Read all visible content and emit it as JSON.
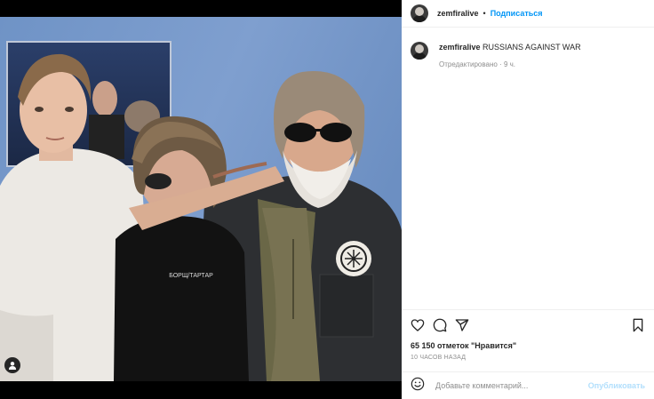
{
  "post": {
    "username": "zemfiralive",
    "follow_label": "Подписаться",
    "separator": "•",
    "caption_text": "RUSSIANS AGAINST WAR",
    "edited_label": "Отредактировано",
    "edited_time": "9 ч.",
    "likes_text": "65 150 отметок \"Нравится\"",
    "time_ago": "10 ЧАСОВ НАЗАД",
    "comment_placeholder": "Добавьте комментарий...",
    "publish_label": "Опубликовать",
    "shirt_text": "БОРЩ/ТАРТАР"
  },
  "colors": {
    "link": "#0095f6",
    "text": "#262626",
    "muted": "#8e8e8e",
    "publish_disabled": "#b2dffc"
  },
  "icons": [
    "heart-icon",
    "comment-icon",
    "share-icon",
    "bookmark-icon",
    "emoji-icon",
    "user-tag-icon"
  ]
}
